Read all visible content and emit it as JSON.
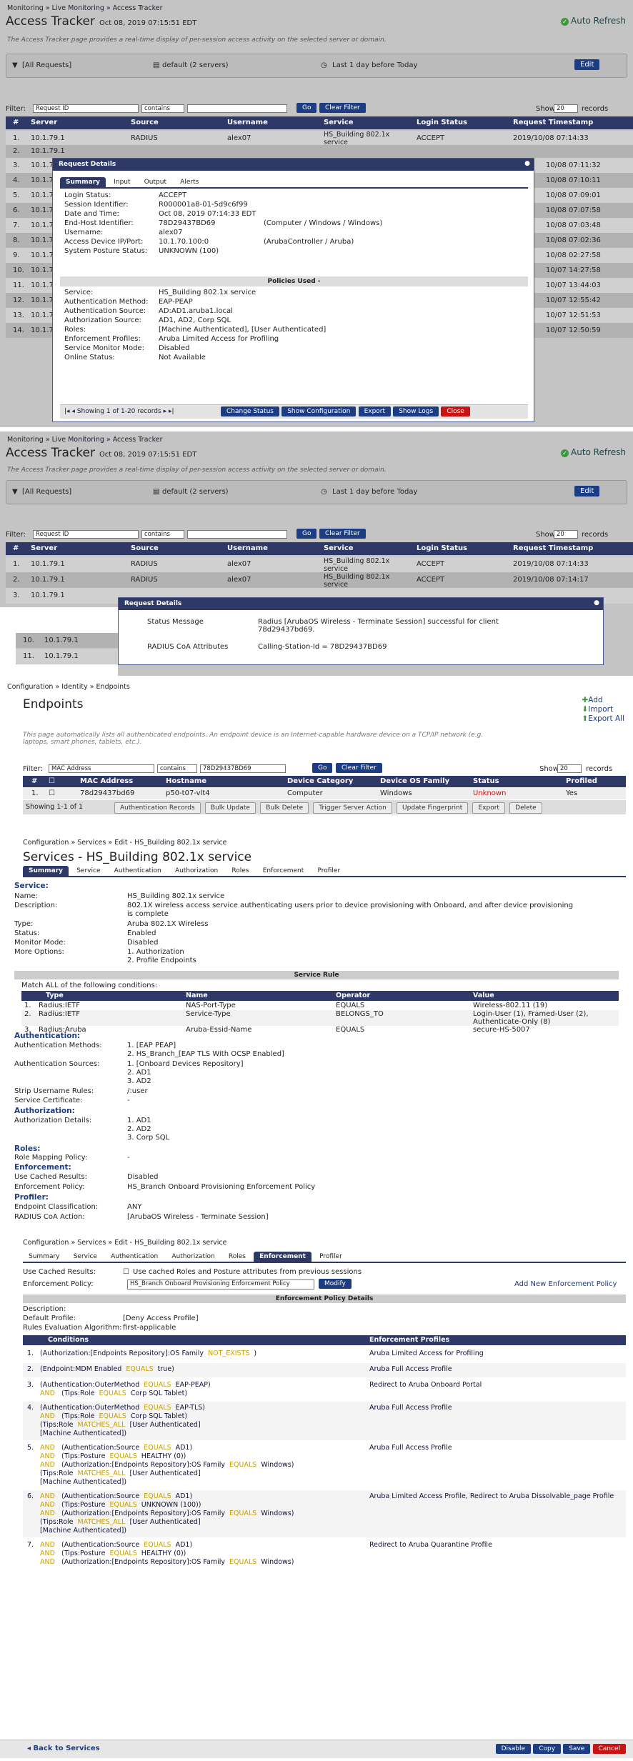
{
  "at": {
    "breadcrumb": "Monitoring » Live Monitoring » Access Tracker",
    "title": "Access Tracker",
    "timestamp": "Oct 08, 2019 07:15:51 EDT",
    "description": "The Access Tracker page provides a real-time display of per-session access activity on the selected server or domain.",
    "auto_refresh": "Auto Refresh",
    "scope": "[All Requests]",
    "servers": "default (2 servers)",
    "period": "Last 1 day before Today",
    "edit": "Edit",
    "filter_label": "Filter:",
    "filter_field": "Request ID",
    "filter_op": "contains",
    "go": "Go",
    "clear_filter": "Clear Filter",
    "show": "Show",
    "show_n": "20",
    "records": "records",
    "cols": [
      "#",
      "Server",
      "Source",
      "Username",
      "Service",
      "Login Status",
      "Request Timestamp"
    ],
    "rows": [
      {
        "n": "1.",
        "server": "10.1.79.1",
        "source": "RADIUS",
        "user": "alex07",
        "service": "HS_Building 802.1x service",
        "status": "ACCEPT",
        "ts": "2019/10/08 07:14:33"
      },
      {
        "n": "2.",
        "server": "10.1.79.1",
        "source": "RADIUS",
        "user": "alex07",
        "service": "HS_Building 802.1x service",
        "status": "ACCEPT",
        "ts": "2019/10/08 07:14:17"
      }
    ],
    "bg_rows": [
      "3.",
      "4.",
      "5.",
      "6.",
      "7.",
      "8.",
      "9.",
      "10.",
      "11.",
      "12.",
      "13.",
      "14."
    ],
    "bg_ts": [
      "10/08 07:11:32",
      "10/08 07:10:11",
      "10/08 07:09:01",
      "10/08 07:07:58",
      "10/08 07:03:48",
      "10/08 07:02:36",
      "10/08 02:27:58",
      "10/07 14:27:58",
      "10/07 13:44:03",
      "10/07 12:55:42",
      "10/07 12:51:53",
      "10/07 12:50:59"
    ]
  },
  "rd1": {
    "title": "Request Details",
    "tabs": [
      "Summary",
      "Input",
      "Output",
      "Alerts"
    ],
    "fields": [
      {
        "k": "Login Status:",
        "v": "ACCEPT"
      },
      {
        "k": "Session Identifier:",
        "v": "R000001a8-01-5d9c6f99"
      },
      {
        "k": "Date and Time:",
        "v": "Oct 08, 2019 07:14:33 EDT"
      },
      {
        "k": "End-Host Identifier:",
        "v": "78D29437BD69",
        "extra": "(Computer / Windows / Windows)"
      },
      {
        "k": "Username:",
        "v": "alex07"
      },
      {
        "k": "Access Device IP/Port:",
        "v": "10.1.70.100:0",
        "extra": "(ArubaController / Aruba)"
      },
      {
        "k": "System Posture Status:",
        "v": "UNKNOWN (100)"
      }
    ],
    "policies_used": "Policies Used -",
    "policies": [
      {
        "k": "Service:",
        "v": "HS_Building 802.1x service"
      },
      {
        "k": "Authentication Method:",
        "v": "EAP-PEAP"
      },
      {
        "k": "Authentication Source:",
        "v": "AD:AD1.aruba1.local"
      },
      {
        "k": "Authorization Source:",
        "v": "AD1, AD2, Corp SQL"
      },
      {
        "k": "Roles:",
        "v": "[Machine Authenticated], [User Authenticated]"
      },
      {
        "k": "Enforcement Profiles:",
        "v": "Aruba Limited Access for Profiling"
      },
      {
        "k": "Service Monitor Mode:",
        "v": "Disabled"
      },
      {
        "k": "Online Status:",
        "v": "Not Available"
      }
    ],
    "pager": "Showing 1 of 1-20 records",
    "buttons": [
      "Change Status",
      "Show Configuration",
      "Export",
      "Show Logs",
      "Close"
    ]
  },
  "at2": {
    "breadcrumb": "Monitoring » Live Monitoring » Access Tracker",
    "title": "Access Tracker",
    "timestamp": "Oct 08, 2019 07:15:51 EDT",
    "rows": [
      {
        "n": "1.",
        "server": "10.1.79.1",
        "source": "RADIUS",
        "user": "alex07",
        "service": "HS_Building 802.1x service",
        "status": "ACCEPT",
        "ts": "2019/10/08 07:14:33"
      },
      {
        "n": "2.",
        "server": "10.1.79.1",
        "source": "RADIUS",
        "user": "alex07",
        "service": "HS_Building 802.1x service",
        "status": "ACCEPT",
        "ts": "2019/10/08 07:14:17"
      },
      {
        "n": "3.",
        "server": "10.1.79.1"
      },
      {
        "n": "10.",
        "server": "10.1.79.1"
      },
      {
        "n": "11.",
        "server": "10.1.79.1"
      }
    ],
    "rd_title": "Request Details",
    "status_msg_k": "Status Message",
    "status_msg_v": "Radius [ArubaOS Wireless - Terminate Session] successful for client 78d29437bd69.",
    "coa_k": "RADIUS CoA Attributes",
    "coa_v": "Calling-Station-Id = 78D29437BD69"
  },
  "ep": {
    "breadcrumb": "Configuration » Identity » Endpoints",
    "title": "Endpoints",
    "add": "Add",
    "import": "Import",
    "export_all": "Export All",
    "description": "This page automatically lists all authenticated endpoints. An endpoint device is an Internet-capable hardware device on a TCP/IP network (e.g. laptops, smart phones, tablets, etc.).",
    "filter_field": "MAC Address",
    "filter_op": "contains",
    "filter_val": "78D29437BD69",
    "cols": [
      "#",
      "MAC Address",
      "Hostname",
      "Device Category",
      "Device OS Family",
      "Status",
      "Profiled"
    ],
    "row": {
      "n": "1.",
      "mac": "78d29437bd69",
      "host": "p50-t07-vlt4",
      "cat": "Computer",
      "os": "Windows",
      "status": "Unknown",
      "prof": "Yes"
    },
    "showing": "Showing 1-1 of 1",
    "buttons": [
      "Authentication Records",
      "Bulk Update",
      "Bulk Delete",
      "Trigger Server Action",
      "Update Fingerprint",
      "Export",
      "Delete"
    ]
  },
  "svc": {
    "breadcrumb": "Configuration » Services » Edit - HS_Building 802.1x service",
    "title": "Services - HS_Building 802.1x service",
    "tabs": [
      "Summary",
      "Service",
      "Authentication",
      "Authorization",
      "Roles",
      "Enforcement",
      "Profiler"
    ],
    "service_h": "Service:",
    "name_k": "Name:",
    "name_v": "HS_Building 802.1x service",
    "desc_k": "Description:",
    "desc_v1": "802.1X wireless access service authenticating users prior to device provisioning with Onboard, and after device provisioning",
    "desc_v2": "is complete",
    "type_k": "Type:",
    "type_v": "Aruba 802.1X Wireless",
    "status_k": "Status:",
    "status_v": "Enabled",
    "mon_k": "Monitor Mode:",
    "mon_v": "Disabled",
    "more_k": "More Options:",
    "more_v1": "1. Authorization",
    "more_v2": "2. Profile Endpoints",
    "rule_band": "Service Rule",
    "match": "Match ALL of the following conditions:",
    "rule_cols": [
      "Type",
      "Name",
      "Operator",
      "Value"
    ],
    "rules": [
      {
        "n": "1.",
        "type": "Radius:IETF",
        "name": "NAS-Port-Type",
        "op": "EQUALS",
        "val": "Wireless-802.11 (19)"
      },
      {
        "n": "2.",
        "type": "Radius:IETF",
        "name": "Service-Type",
        "op": "BELONGS_TO",
        "val": "Login-User (1), Framed-User (2), Authenticate-Only (8)"
      },
      {
        "n": "3.",
        "type": "Radius:Aruba",
        "name": "Aruba-Essid-Name",
        "op": "EQUALS",
        "val": "secure-HS-5007"
      }
    ],
    "authn_h": "Authentication:",
    "am_k": "Authentication Methods:",
    "am_v1": "1. [EAP PEAP]",
    "am_v2": "2. HS_Branch_[EAP TLS With OCSP Enabled]",
    "as_k": "Authentication Sources:",
    "as_v1": "1. [Onboard Devices Repository]",
    "as_v2": "2. AD1",
    "as_v3": "3. AD2",
    "strip_k": "Strip Username Rules:",
    "strip_v": "/:user",
    "cert_k": "Service Certificate:",
    "cert_v": "-",
    "authz_h": "Authorization:",
    "ad_k": "Authorization Details:",
    "ad_v1": "1. AD1",
    "ad_v2": "2. AD2",
    "ad_v3": "3. Corp SQL",
    "roles_h": "Roles:",
    "rmp_k": "Role Mapping Policy:",
    "rmp_v": "-",
    "enf_h": "Enforcement:",
    "ucr_k": "Use Cached Results:",
    "ucr_v": "Disabled",
    "ep_k": "Enforcement Policy:",
    "ep_v": "HS_Branch Onboard Provisioning Enforcement Policy",
    "prof_h": "Profiler:",
    "ec_k": "Endpoint Classification:",
    "ec_v": "ANY",
    "coa_k": "RADIUS CoA Action:",
    "coa_v": "[ArubaOS Wireless - Terminate Session]"
  },
  "enf": {
    "breadcrumb": "Configuration » Services » Edit - HS_Building 802.1x service",
    "tabs": [
      "Summary",
      "Service",
      "Authentication",
      "Authorization",
      "Roles",
      "Enforcement",
      "Profiler"
    ],
    "ucr_k": "Use Cached Results:",
    "ucr_v": "Use cached Roles and Posture attributes from previous sessions",
    "ep_k": "Enforcement Policy:",
    "ep_v": "HS_Branch Onboard Provisioning Enforcement Policy",
    "modify": "Modify",
    "add_new": "Add New Enforcement Policy",
    "band": "Enforcement Policy Details",
    "d_k": "Description:",
    "dp_k": "Default Profile:",
    "dp_v": "[Deny Access Profile]",
    "rea_k": "Rules Evaluation Algorithm:",
    "rea_v": "first-applicable",
    "cols": [
      "Conditions",
      "Enforcement Profiles"
    ],
    "rules": [
      {
        "n": "1.",
        "c": [
          "(Authorization:[Endpoints Repository]:OS Family  NOT_EXISTS  )"
        ],
        "p": "Aruba Limited Access for Profiling"
      },
      {
        "n": "2.",
        "c": [
          "(Endpoint:MDM Enabled  EQUALS  true)"
        ],
        "p": "Aruba Full Access Profile"
      },
      {
        "n": "3.",
        "c": [
          "(Authentication:OuterMethod  EQUALS  EAP-PEAP)",
          "AND   (Tips:Role  EQUALS  Corp SQL Tablet)"
        ],
        "p": "Redirect to Aruba Onboard Portal"
      },
      {
        "n": "4.",
        "c": [
          "(Authentication:OuterMethod  EQUALS  EAP-TLS)",
          "AND   (Tips:Role  EQUALS  Corp SQL Tablet)",
          "(Tips:Role  MATCHES_ALL  [User Authenticated]",
          "[Machine Authenticated])"
        ],
        "p": "Aruba Full Access Profile"
      },
      {
        "n": "5.",
        "c": [
          "AND   (Authentication:Source  EQUALS  AD1)",
          "AND   (Tips:Posture  EQUALS  HEALTHY (0))",
          "AND   (Authorization:[Endpoints Repository]:OS Family  EQUALS  Windows)",
          "(Tips:Role  MATCHES_ALL  [User Authenticated]",
          "[Machine Authenticated])"
        ],
        "p": "Aruba Full Access Profile"
      },
      {
        "n": "6.",
        "c": [
          "AND   (Authentication:Source  EQUALS  AD1)",
          "AND   (Tips:Posture  EQUALS  UNKNOWN (100))",
          "AND   (Authorization:[Endpoints Repository]:OS Family  EQUALS  Windows)",
          "(Tips:Role  MATCHES_ALL  [User Authenticated]",
          "[Machine Authenticated])"
        ],
        "p": "Aruba Limited Access Profile, Redirect to Aruba Dissolvable_page Profile"
      },
      {
        "n": "7.",
        "c": [
          "AND   (Authentication:Source  EQUALS  AD1)",
          "AND   (Tips:Posture  EQUALS  HEALTHY (0))",
          "AND   (Authorization:[Endpoints Repository]:OS Family  EQUALS  Windows)"
        ],
        "p": "Redirect to Aruba Quarantine Profile"
      }
    ],
    "back": "Back to Services",
    "buttons": [
      "Disable",
      "Copy",
      "Save",
      "Cancel"
    ]
  },
  "colors": {
    "header": "#2e3968",
    "button": "#1d3d82",
    "danger": "#c81414",
    "section": "#1d3d82"
  }
}
